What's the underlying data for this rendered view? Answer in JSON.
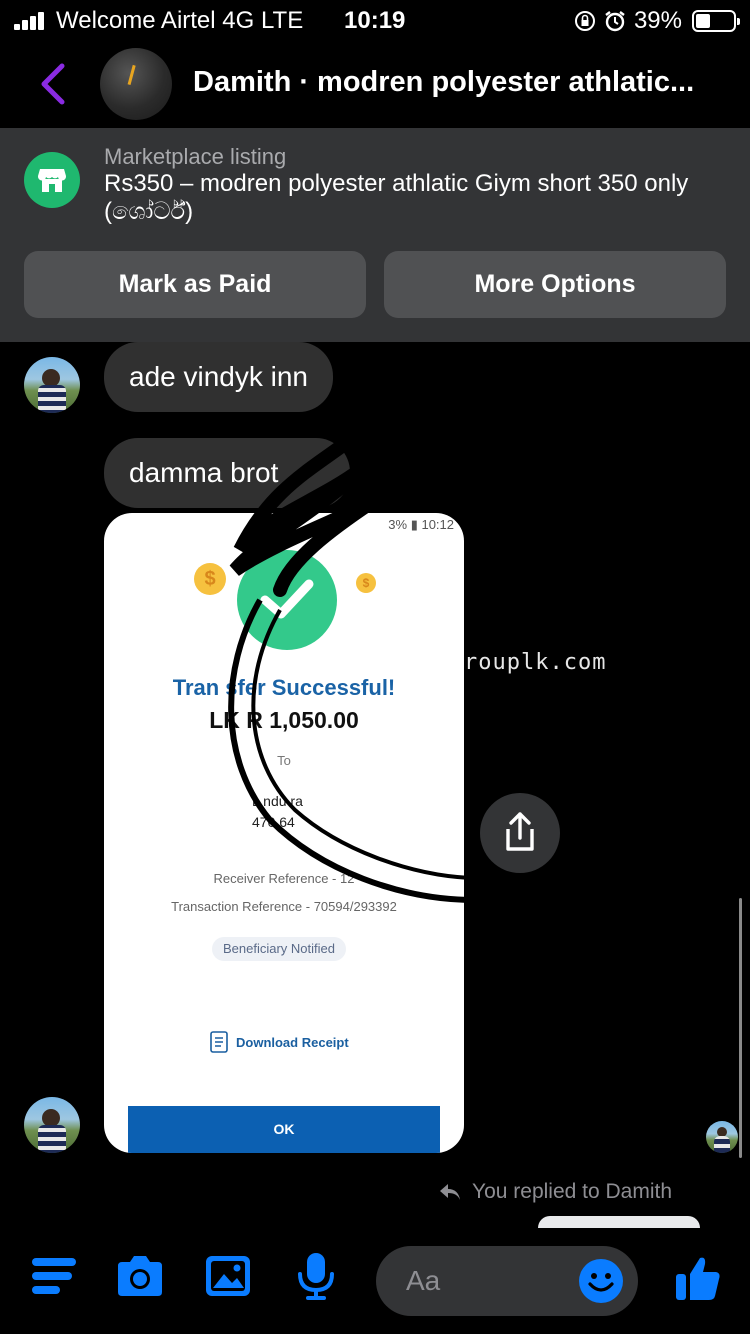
{
  "status_bar": {
    "carrier": "Welcome Airtel 4G  LTE",
    "time": "10:19",
    "battery": "39%"
  },
  "header": {
    "title": "Damith · modren polyester athlatic..."
  },
  "listing": {
    "label": "Marketplace listing",
    "description": "Rs350 – modren polyester athlatic Giym short 350 only (ශෝර්ට්)",
    "mark_paid": "Mark as Paid",
    "more_options": "More Options"
  },
  "messages": [
    {
      "text": "ade vindyk inn"
    },
    {
      "text": "damma brot"
    }
  ],
  "receipt": {
    "status": "3% ▮ 10:12",
    "title": "Tran sfer Successful!",
    "amount": "LK R 1,050.00",
    "to": "To",
    "name": "L ndu ra",
    "account": "470 64",
    "receiver_ref": "Receiver Reference - 12",
    "transaction_ref": "Transaction Reference - 70594/293392",
    "badge": "Beneficiary Notified",
    "download": "Download Receipt",
    "ok": "OK"
  },
  "watermark": "rouplk.com",
  "replied_label": "You replied to Damith",
  "composer": {
    "placeholder": "Aa"
  },
  "colors": {
    "accent": "#0a7cff",
    "back": "#8a2be2",
    "marketplace_green": "#1fb86f",
    "success_green": "#33c98b",
    "receipt_blue": "#0c60b2"
  },
  "icons": [
    "back-chevron-icon",
    "marketplace-store-icon",
    "share-icon",
    "reply-arrow-icon",
    "menu-icon",
    "camera-icon",
    "gallery-icon",
    "microphone-icon",
    "emoji-icon",
    "thumbs-up-icon"
  ]
}
